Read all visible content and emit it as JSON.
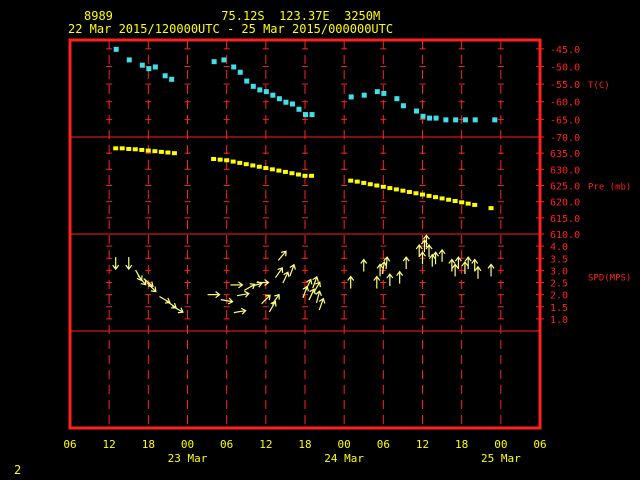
{
  "header": {
    "station_id": "8989",
    "location": "75.12S  123.37E  3250M",
    "time_range": "22 Mar 2015/120000UTC - 25 Mar 2015/000000UTC"
  },
  "footer": {
    "page_number": "2"
  },
  "colors": {
    "frame": "#ff2020",
    "grid": "#ff2020",
    "temp": "#40e0e8",
    "pressure": "#ffff00",
    "wind": "#ffff80",
    "text": "#ffff00"
  },
  "chart_data": {
    "type": "scatter",
    "x_axis": {
      "unit": "hours since 2015-03-22 06:00 UTC",
      "range": [
        0,
        72
      ],
      "tick_labels": [
        "06",
        "12",
        "18",
        "00",
        "06",
        "12",
        "18",
        "00",
        "06",
        "12",
        "18",
        "00",
        "06"
      ],
      "date_labels": [
        {
          "x": 18,
          "label": "23 Mar"
        },
        {
          "x": 42,
          "label": "24 Mar"
        },
        {
          "x": 66,
          "label": "25 Mar"
        }
      ]
    },
    "panels": [
      {
        "name": "temperature",
        "label": "T(C)",
        "range": [
          -70,
          -42.5
        ],
        "ticks": [
          "-45.0",
          "-50.0",
          "-55.0",
          "-60.0",
          "-65.0",
          "-70.0"
        ],
        "tick_values": [
          -45,
          -50,
          -55,
          -60,
          -65,
          -70
        ],
        "label_at": -55,
        "points": [
          [
            7,
            -45
          ],
          [
            9,
            -48
          ],
          [
            11,
            -49.5
          ],
          [
            12,
            -50.5
          ],
          [
            13,
            -50
          ],
          [
            14.5,
            -52.5
          ],
          [
            15.5,
            -53.5
          ],
          [
            22,
            -48.5
          ],
          [
            23.5,
            -48
          ],
          [
            25,
            -50
          ],
          [
            26,
            -51.5
          ],
          [
            27,
            -54
          ],
          [
            28,
            -55.5
          ],
          [
            29,
            -56.5
          ],
          [
            30,
            -57
          ],
          [
            31,
            -58
          ],
          [
            32,
            -59
          ],
          [
            33,
            -60
          ],
          [
            34,
            -60.5
          ],
          [
            35,
            -62
          ],
          [
            36,
            -63.5
          ],
          [
            37,
            -63.5
          ],
          [
            43,
            -58.5
          ],
          [
            45,
            -58
          ],
          [
            47,
            -57
          ],
          [
            48,
            -57.5
          ],
          [
            50,
            -59
          ],
          [
            51,
            -61
          ],
          [
            53,
            -62.5
          ],
          [
            54,
            -64
          ],
          [
            55,
            -64.5
          ],
          [
            56,
            -64.5
          ],
          [
            57.5,
            -65
          ],
          [
            59,
            -65
          ],
          [
            60.5,
            -65
          ],
          [
            62,
            -65
          ],
          [
            65,
            -65
          ]
        ]
      },
      {
        "name": "pressure",
        "label": "Pre (mb)",
        "range": [
          610,
          640
        ],
        "ticks": [
          "635.0",
          "630.0",
          "625.0",
          "620.0",
          "615.0",
          "610.0"
        ],
        "tick_values": [
          635,
          630,
          625,
          620,
          615,
          610
        ],
        "label_at": 625,
        "points": [
          [
            7,
            636.5
          ],
          [
            8,
            636.5
          ],
          [
            9,
            636.3
          ],
          [
            10,
            636.2
          ],
          [
            11,
            636
          ],
          [
            12,
            635.8
          ],
          [
            13,
            635.6
          ],
          [
            14,
            635.4
          ],
          [
            15,
            635.2
          ],
          [
            16,
            635
          ],
          [
            22,
            633.2
          ],
          [
            23,
            633
          ],
          [
            24,
            632.8
          ],
          [
            25,
            632.4
          ],
          [
            26,
            632
          ],
          [
            27,
            631.6
          ],
          [
            28,
            631.2
          ],
          [
            29,
            630.8
          ],
          [
            30,
            630.4
          ],
          [
            31,
            630
          ],
          [
            32,
            629.6
          ],
          [
            33,
            629.2
          ],
          [
            34,
            628.8
          ],
          [
            35,
            628.4
          ],
          [
            36,
            628
          ],
          [
            37,
            628
          ],
          [
            43,
            626.5
          ],
          [
            44,
            626.2
          ],
          [
            45,
            625.8
          ],
          [
            46,
            625.4
          ],
          [
            47,
            625
          ],
          [
            48,
            624.6
          ],
          [
            49,
            624.2
          ],
          [
            50,
            623.8
          ],
          [
            51,
            623.4
          ],
          [
            52,
            623
          ],
          [
            53,
            622.6
          ],
          [
            54,
            622.2
          ],
          [
            55,
            621.8
          ],
          [
            56,
            621.4
          ],
          [
            57,
            621
          ],
          [
            58,
            620.6
          ],
          [
            59,
            620.2
          ],
          [
            60,
            619.8
          ],
          [
            61,
            619.4
          ],
          [
            62,
            619
          ],
          [
            64.5,
            618
          ]
        ]
      },
      {
        "name": "wind_speed",
        "label": "SPD(MPS)",
        "range": [
          0.5,
          4.5
        ],
        "ticks": [
          "4.0",
          "3.5",
          "3.0",
          "2.5",
          "2.0",
          "1.5",
          "1.0"
        ],
        "tick_values": [
          4,
          3.5,
          3,
          2.5,
          2,
          1.5,
          1
        ],
        "label_at": 2.75,
        "note": "wind arrows: speed (m/s) with direction in screen degrees (0 = pointing up, clockwise)",
        "points": [
          [
            7,
            3.3,
            180
          ],
          [
            9,
            3.3,
            180
          ],
          [
            10.5,
            2.8,
            150
          ],
          [
            11,
            2.6,
            140
          ],
          [
            12,
            2.5,
            130
          ],
          [
            12.5,
            2.3,
            135
          ],
          [
            14.5,
            1.8,
            120
          ],
          [
            15.5,
            1.6,
            125
          ],
          [
            16.5,
            1.4,
            120
          ],
          [
            22,
            2.0,
            90
          ],
          [
            24,
            1.75,
            100
          ],
          [
            25.5,
            2.4,
            90
          ],
          [
            26.5,
            2.0,
            80
          ],
          [
            26,
            1.3,
            80
          ],
          [
            27.5,
            2.3,
            60
          ],
          [
            28.5,
            2.4,
            75
          ],
          [
            29.5,
            2.5,
            90
          ],
          [
            30,
            1.8,
            45
          ],
          [
            31,
            1.5,
            30
          ],
          [
            31.5,
            1.8,
            35
          ],
          [
            32,
            2.9,
            35
          ],
          [
            32.5,
            3.6,
            40
          ],
          [
            33,
            2.7,
            25
          ],
          [
            34,
            3.0,
            20
          ],
          [
            36,
            2.1,
            20
          ],
          [
            36.5,
            2.4,
            25
          ],
          [
            37,
            2.0,
            25
          ],
          [
            37.5,
            2.5,
            20
          ],
          [
            37.8,
            2.3,
            30
          ],
          [
            38,
            1.9,
            15
          ],
          [
            38.5,
            1.6,
            20
          ],
          [
            43,
            2.5,
            0
          ],
          [
            45,
            3.2,
            0
          ],
          [
            47,
            2.5,
            0
          ],
          [
            47.5,
            3.0,
            0
          ],
          [
            48,
            3.1,
            10
          ],
          [
            48.5,
            3.3,
            5
          ],
          [
            49,
            2.6,
            0
          ],
          [
            50.5,
            2.7,
            0
          ],
          [
            51.5,
            3.3,
            0
          ],
          [
            53.5,
            3.8,
            0
          ],
          [
            54,
            3.5,
            0
          ],
          [
            54.3,
            4.0,
            0
          ],
          [
            54.6,
            4.2,
            0
          ],
          [
            55,
            3.8,
            0
          ],
          [
            55.5,
            3.4,
            0
          ],
          [
            56,
            3.5,
            0
          ],
          [
            57,
            3.6,
            0
          ],
          [
            58.5,
            3.2,
            0
          ],
          [
            59,
            3.0,
            0
          ],
          [
            59.5,
            3.3,
            0
          ],
          [
            60.5,
            3.1,
            0
          ],
          [
            61,
            3.3,
            0
          ],
          [
            62,
            3.2,
            0
          ],
          [
            62.5,
            2.9,
            0
          ],
          [
            64.5,
            3.0,
            0
          ]
        ]
      },
      {
        "name": "empty",
        "label": "",
        "range": [
          0,
          1
        ],
        "ticks": [],
        "tick_values": [],
        "points": []
      }
    ],
    "grid": true
  }
}
